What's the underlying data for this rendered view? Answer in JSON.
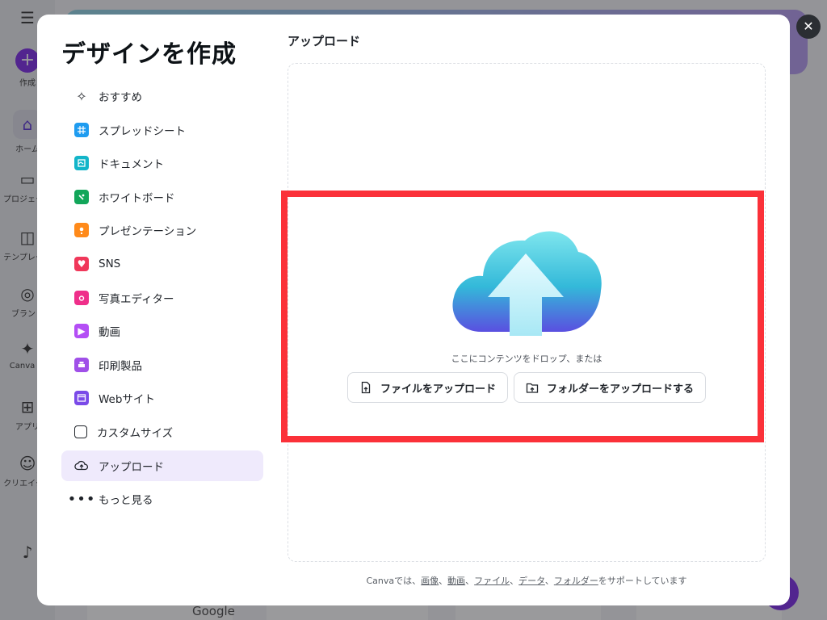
{
  "background": {
    "rail": [
      {
        "label": "作成",
        "icon": "plus-icon"
      },
      {
        "label": "ホーム",
        "icon": "home-icon"
      },
      {
        "label": "プロジェクト",
        "icon": "folder-icon"
      },
      {
        "label": "テンプレート",
        "icon": "template-icon"
      },
      {
        "label": "ブランド",
        "icon": "brand-icon"
      },
      {
        "label": "Canva AI",
        "icon": "sparkle-icon"
      },
      {
        "label": "アプリ",
        "icon": "apps-icon"
      },
      {
        "label": "クリエイター",
        "icon": "creator-icon"
      }
    ],
    "google_label": "Google"
  },
  "modal": {
    "title": "デザインを作成",
    "close_label": "✕",
    "menu": [
      {
        "label": "おすすめ",
        "icon": "sparkle-icon"
      },
      {
        "label": "スプレッドシート",
        "icon": "spreadsheet-icon"
      },
      {
        "label": "ドキュメント",
        "icon": "document-icon"
      },
      {
        "label": "ホワイトボード",
        "icon": "whiteboard-icon"
      },
      {
        "label": "プレゼンテーション",
        "icon": "presentation-icon"
      },
      {
        "label": "SNS",
        "icon": "heart-icon"
      },
      {
        "label": "写真エディター",
        "icon": "camera-icon"
      },
      {
        "label": "動画",
        "icon": "video-icon"
      },
      {
        "label": "印刷製品",
        "icon": "printer-icon"
      },
      {
        "label": "Webサイト",
        "icon": "website-icon"
      },
      {
        "label": "カスタムサイズ",
        "icon": "resize-icon"
      },
      {
        "label": "アップロード",
        "icon": "cloud-upload-icon"
      },
      {
        "label": "もっと見る",
        "icon": "more-icon"
      }
    ],
    "active_menu_index": 11,
    "section_title": "アップロード",
    "drop_text": "ここにコンテンツをドロップ、または",
    "upload_file_label": "ファイルをアップロード",
    "upload_folder_label": "フォルダーをアップロードする",
    "footer": {
      "prefix": "Canvaでは、",
      "links": [
        "画像",
        "動画",
        "ファイル",
        "データ",
        "フォルダー"
      ],
      "separator": "、",
      "suffix": "をサポートしています"
    }
  }
}
